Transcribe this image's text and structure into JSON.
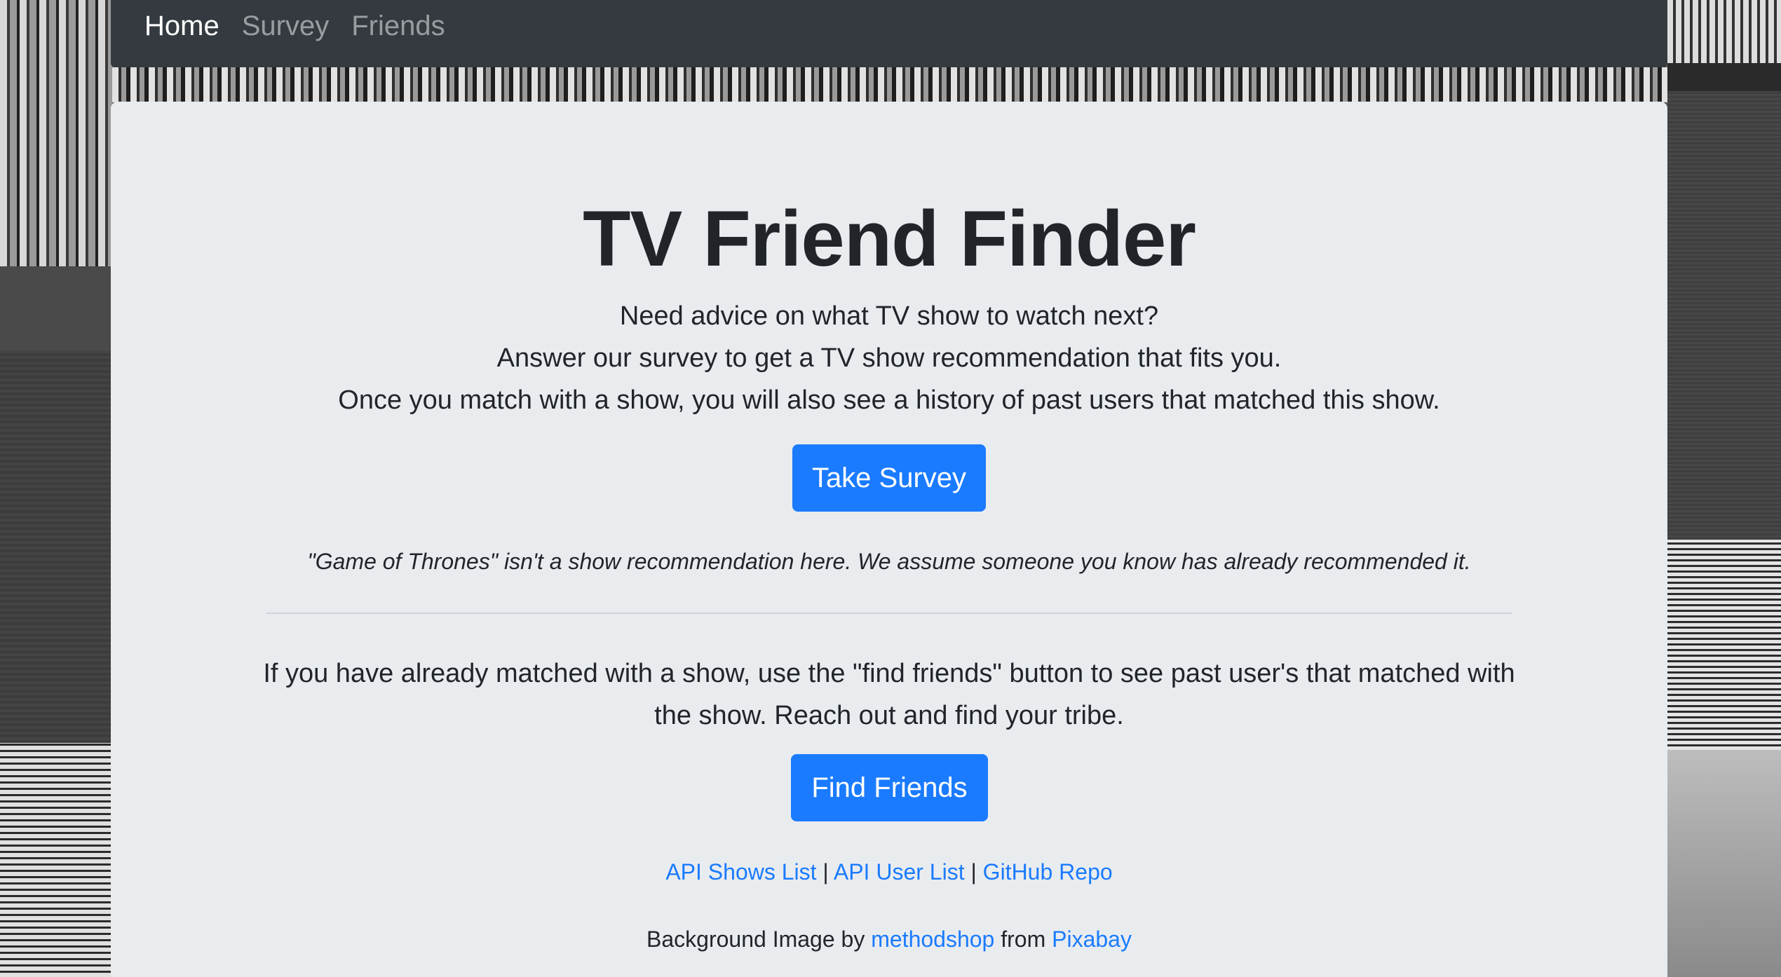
{
  "nav": {
    "items": [
      {
        "label": "Home",
        "active": true
      },
      {
        "label": "Survey",
        "active": false
      },
      {
        "label": "Friends",
        "active": false
      }
    ]
  },
  "hero": {
    "title": "TV Friend Finder",
    "lead_lines": [
      "Need advice on what TV show to watch next?",
      "Answer our survey to get a TV show recommendation that fits you.",
      "Once you match with a show, you will also see a history of past users that matched this show."
    ],
    "survey_button": "Take Survey",
    "note": "\"Game of Thrones\" isn't a show recommendation here. We assume someone you know has already recommended it.",
    "find_friends_text": "If you have already matched with a show, use the \"find friends\" button to see past user's that matched with the show. Reach out and find your tribe.",
    "friends_button": "Find Friends"
  },
  "links": {
    "items": [
      "API Shows List",
      "API User List",
      "GitHub Repo"
    ],
    "separator": "|"
  },
  "credit": {
    "prefix": "Background Image by",
    "author": "methodshop",
    "middle": "from",
    "source": "Pixabay"
  },
  "colors": {
    "navbar": "#343a40",
    "jumbotron": "#e9ecef",
    "primary": "#1a7bff",
    "text": "#212529"
  }
}
